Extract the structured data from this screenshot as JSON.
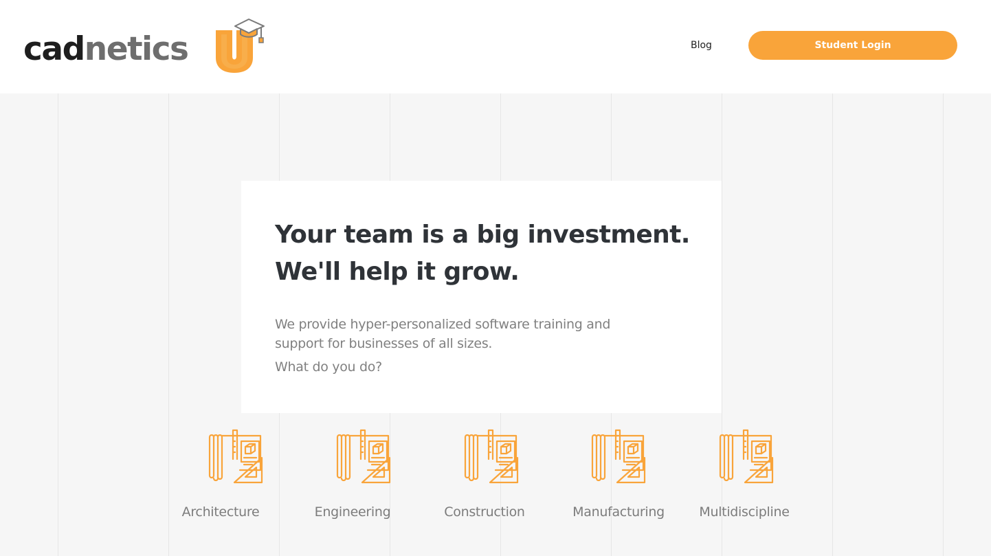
{
  "brand": {
    "logo_part1": "cad",
    "logo_part2": "netics",
    "logo_mark": "U",
    "logo_mark_color": "#f9a43a"
  },
  "nav": {
    "blog": "Blog",
    "login": "Student Login"
  },
  "colors": {
    "accent": "#f9a43a",
    "heading": "#2f3338",
    "body_text": "#808080",
    "page_background": "#f6f6f6"
  },
  "hero": {
    "headline_line1": "Your team is a big investment.",
    "headline_line2": "We'll help it grow.",
    "description": "We provide hyper-personalized software training and support for businesses of all sizes.",
    "question": "What do you do?"
  },
  "industries": [
    {
      "label": "Architecture",
      "icon": "blueprint-tools-icon"
    },
    {
      "label": "Engineering",
      "icon": "blueprint-tools-icon"
    },
    {
      "label": "Construction",
      "icon": "blueprint-tools-icon"
    },
    {
      "label": "Manufacturing",
      "icon": "blueprint-tools-icon"
    },
    {
      "label": "Multidiscipline",
      "icon": "blueprint-tools-icon"
    }
  ]
}
